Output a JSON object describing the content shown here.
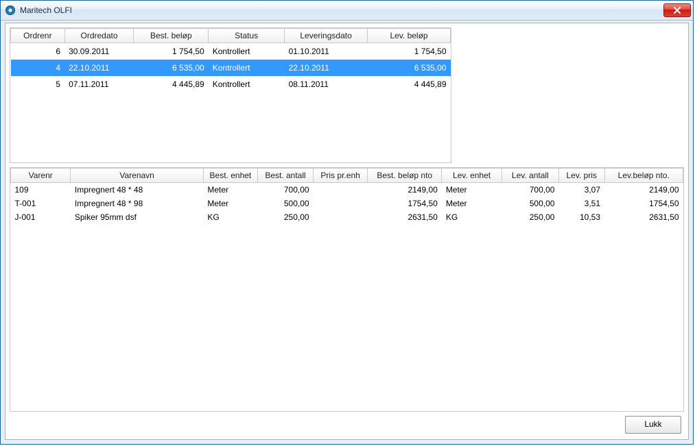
{
  "window": {
    "title": "Maritech OLFI",
    "close_button_aria": "Close"
  },
  "orders": {
    "headers": {
      "ordrenr": "Ordrenr",
      "ordredato": "Ordredato",
      "best_belop": "Best. beløp",
      "status": "Status",
      "leveringsdato": "Leveringsdato",
      "lev_belop": "Lev. beløp"
    },
    "rows": [
      {
        "ordrenr": "6",
        "ordredato": "30.09.2011",
        "best_belop": "1 754,50",
        "status": "Kontrollert",
        "leveringsdato": "01.10.2011",
        "lev_belop": "1 754,50",
        "selected": false
      },
      {
        "ordrenr": "4",
        "ordredato": "22.10.2011",
        "best_belop": "6 535,00",
        "status": "Kontrollert",
        "leveringsdato": "22.10.2011",
        "lev_belop": "6 535,00",
        "selected": true
      },
      {
        "ordrenr": "5",
        "ordredato": "07.11.2011",
        "best_belop": "4 445,89",
        "status": "Kontrollert",
        "leveringsdato": "08.11.2011",
        "lev_belop": "4 445,89",
        "selected": false
      }
    ]
  },
  "lines": {
    "headers": {
      "varenr": "Varenr",
      "varenavn": "Varenavn",
      "best_enhet": "Best. enhet",
      "best_antall": "Best. antall",
      "pris_pr_enh": "Pris pr.enh",
      "best_belop_nto": "Best. beløp nto",
      "lev_enhet": "Lev. enhet",
      "lev_antall": "Lev. antall",
      "lev_pris": "Lev. pris",
      "lev_belop_nto": "Lev.beløp nto."
    },
    "rows": [
      {
        "varenr": "109",
        "varenavn": "Impregnert 48 * 48",
        "best_enhet": "Meter",
        "best_antall": "700,00",
        "pris_pr_enh": "",
        "best_belop_nto": "2149,00",
        "lev_enhet": "Meter",
        "lev_antall": "700,00",
        "lev_pris": "3,07",
        "lev_belop_nto": "2149,00"
      },
      {
        "varenr": "T-001",
        "varenavn": "Impregnert 48 * 98",
        "best_enhet": "Meter",
        "best_antall": "500,00",
        "pris_pr_enh": "",
        "best_belop_nto": "1754,50",
        "lev_enhet": "Meter",
        "lev_antall": "500,00",
        "lev_pris": "3,51",
        "lev_belop_nto": "1754,50"
      },
      {
        "varenr": "J-001",
        "varenavn": "Spiker 95mm dsf",
        "best_enhet": "KG",
        "best_antall": "250,00",
        "pris_pr_enh": "",
        "best_belop_nto": "2631,50",
        "lev_enhet": "KG",
        "lev_antall": "250,00",
        "lev_pris": "10,53",
        "lev_belop_nto": "2631,50"
      }
    ]
  },
  "buttons": {
    "lukk": "Lukk"
  }
}
